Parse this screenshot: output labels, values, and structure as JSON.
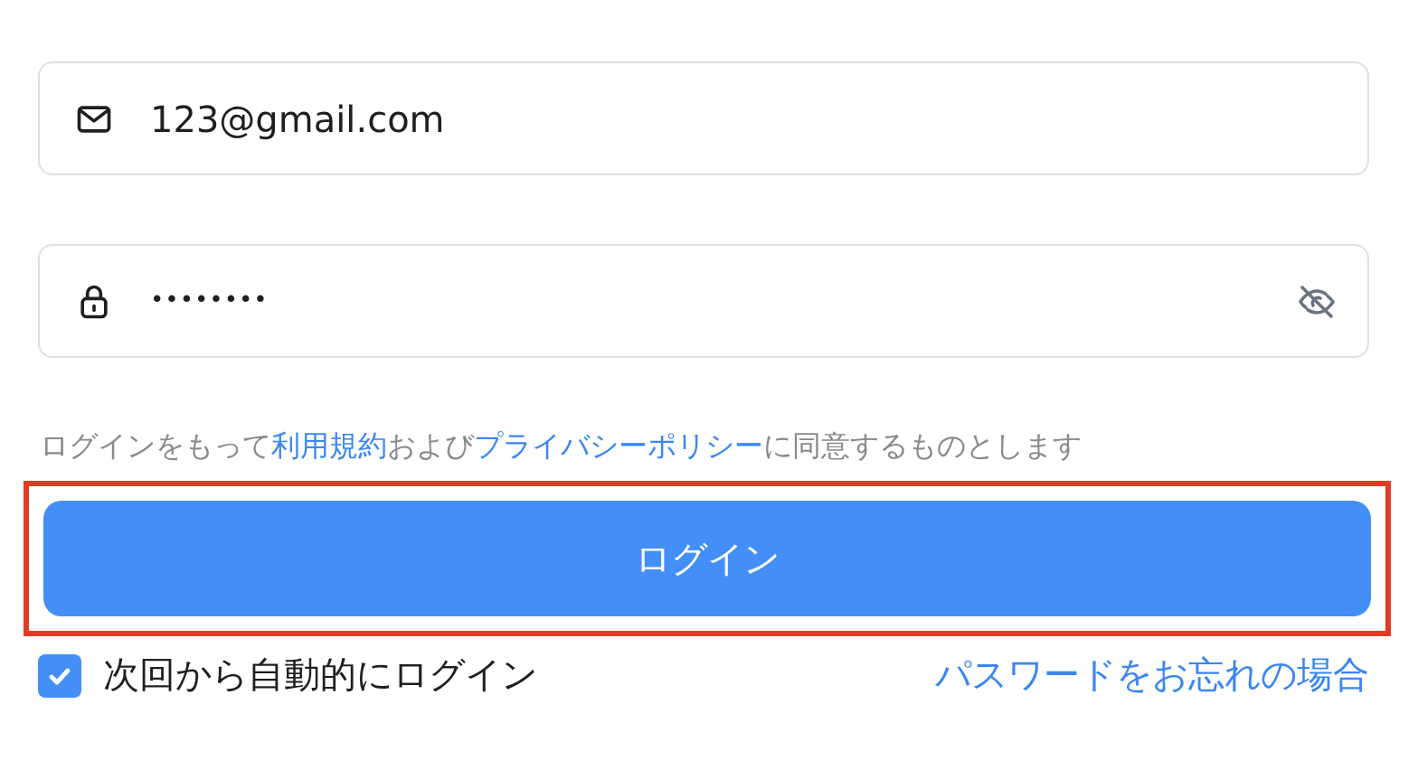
{
  "email_field": {
    "value": "123@gmail.com"
  },
  "password_field": {
    "value": "••••••••",
    "password_visible": false
  },
  "agreement": [
    {
      "kind": "plain",
      "text": "ログインをもって"
    },
    {
      "kind": "link",
      "text": "利用規約"
    },
    {
      "kind": "plain",
      "text": "および"
    },
    {
      "kind": "link",
      "text": "プライバシーポリシー"
    },
    {
      "kind": "plain",
      "text": "に同意するものとします"
    }
  ],
  "login_button": {
    "label": "ログイン",
    "highlighted": true
  },
  "remember_me": {
    "label": "次回から自動的にログイン",
    "checked": true
  },
  "forgot_password_link": "パスワードをお忘れの場合"
}
